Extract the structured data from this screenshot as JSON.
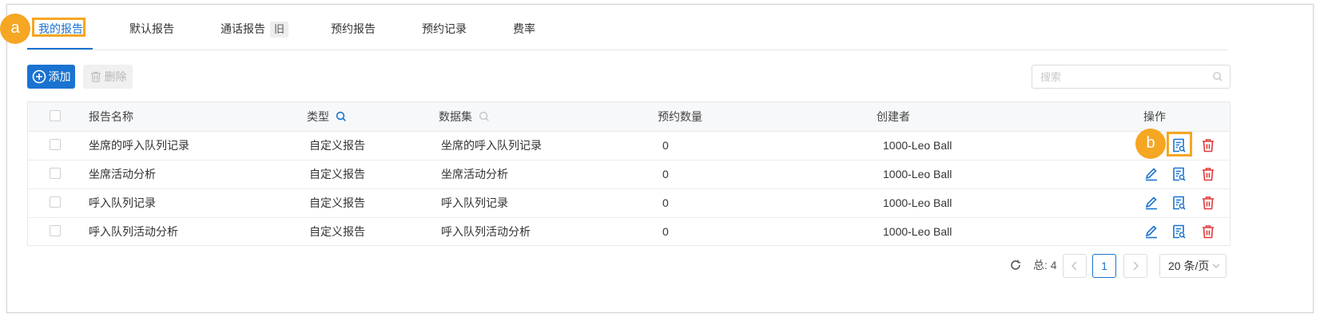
{
  "tabs": [
    {
      "label": "我的报告",
      "active": true
    },
    {
      "label": "默认报告"
    },
    {
      "label": "通话报告",
      "badge": "旧"
    },
    {
      "label": "预约报告"
    },
    {
      "label": "预约记录"
    },
    {
      "label": "费率"
    }
  ],
  "callouts": {
    "a": "a",
    "b": "b"
  },
  "toolbar": {
    "add_label": "添加",
    "delete_label": "删除"
  },
  "search": {
    "placeholder": "搜索"
  },
  "table": {
    "headers": [
      "报告名称",
      "类型",
      "数据集",
      "预约数量",
      "创建者",
      "操作"
    ],
    "rows": [
      {
        "name": "坐席的呼入队列记录",
        "type": "自定义报告",
        "dataset": "坐席的呼入队列记录",
        "scheduled": "0",
        "creator": "1000-Leo Ball"
      },
      {
        "name": "坐席活动分析",
        "type": "自定义报告",
        "dataset": "坐席活动分析",
        "scheduled": "0",
        "creator": "1000-Leo Ball"
      },
      {
        "name": "呼入队列记录",
        "type": "自定义报告",
        "dataset": "呼入队列记录",
        "scheduled": "0",
        "creator": "1000-Leo Ball"
      },
      {
        "name": "呼入队列活动分析",
        "type": "自定义报告",
        "dataset": "呼入队列活动分析",
        "scheduled": "0",
        "creator": "1000-Leo Ball"
      }
    ]
  },
  "pagination": {
    "total_label": "总: 4",
    "current_page": "1",
    "page_size": "20 条/页"
  },
  "colors": {
    "accent": "#1a73d0",
    "highlight": "#f5a623",
    "danger": "#e03a3a"
  },
  "icons": [
    "refresh-icon",
    "search-icon",
    "plus-circle-icon",
    "trash-icon",
    "edit-icon",
    "view-report-icon",
    "delete-icon",
    "chevron-left-icon",
    "chevron-right-icon",
    "chevron-down-icon"
  ]
}
